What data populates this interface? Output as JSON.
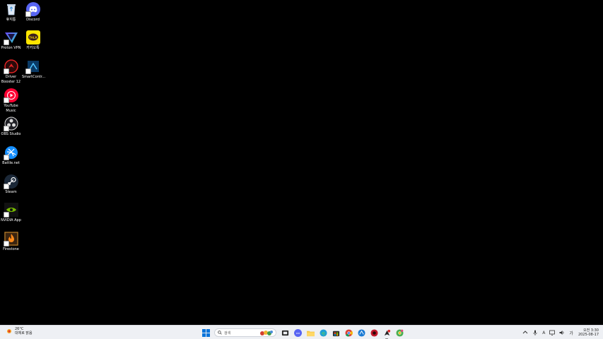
{
  "desktop": {
    "icons": [
      {
        "label": "휴지통",
        "icon": "recycle-bin-icon"
      },
      {
        "label": "Discord",
        "icon": "discord-icon"
      },
      {
        "label": "Proton VPN",
        "icon": "proton-vpn-icon"
      },
      {
        "label": "카카오톡",
        "icon": "kakaotalk-icon"
      },
      {
        "label": "Driver\nBooster 12",
        "icon": "driver-booster-icon"
      },
      {
        "label": "SmartContr...",
        "icon": "smartcontrol-icon"
      },
      {
        "label": "YouTube\nMusic",
        "icon": "youtube-music-icon"
      },
      {
        "label": "OBS Studio",
        "icon": "obs-studio-icon"
      },
      {
        "label": "Battle.net",
        "icon": "battlenet-icon"
      },
      {
        "label": "Steam",
        "icon": "steam-icon"
      },
      {
        "label": "NVIDIA App",
        "icon": "nvidia-app-icon"
      },
      {
        "label": "Firestone",
        "icon": "firestone-icon"
      }
    ]
  },
  "taskbar": {
    "weather": {
      "temp": "26°C",
      "desc": "대체로 맑음"
    },
    "search_placeholder": "검색",
    "tray": {
      "ime": "A",
      "lang": "가",
      "time": "오전 3:30",
      "date": "2025-08-17"
    }
  },
  "colors": {
    "discord": "#5865F2",
    "kakao": "#FEE500",
    "youtube": "#FF0033",
    "battlenet": "#148EFF",
    "nvidia": "#76B900",
    "taskbar_bg": "#eef0f4"
  }
}
